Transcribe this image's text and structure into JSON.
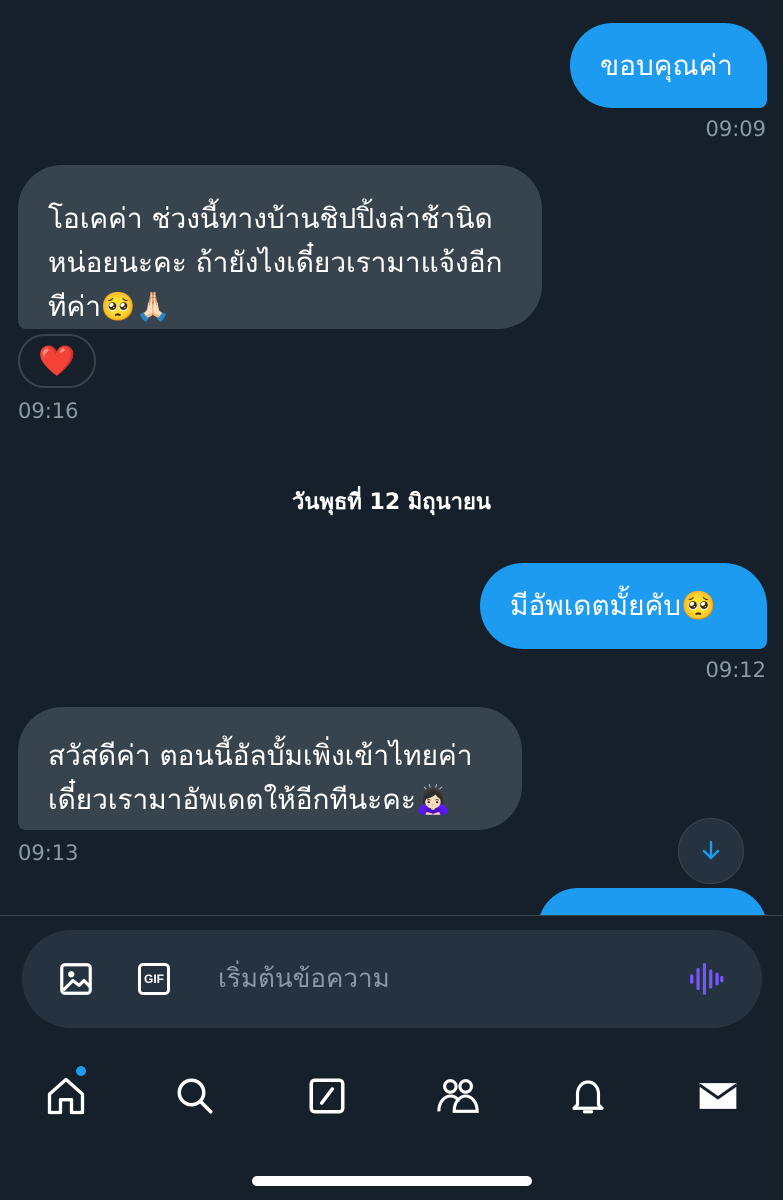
{
  "messages": [
    {
      "text": "ขอบคุณค่า",
      "time": "09:09"
    },
    {
      "line1": "โอเคค่า ช่วงนี้ทางบ้านชิปปิ้งล่าช้านิด",
      "line2": "หน่อยนะคะ ถ้ายังไงเดี๋ยวเรามาแจ้งอีก",
      "line3": "ทีค่า🥺🙏🏻",
      "reaction": "❤️",
      "time": "09:16"
    },
    {
      "text": "มีอัพเดตมั้ยคับ🥺",
      "time": "09:12"
    },
    {
      "line1": "สวัสดีค่า ตอนนี้อัลบั้มเพิ่งเข้าไทยค่า",
      "line2": "เดี๋ยวเรามาอัพเดตให้อีกทีนะคะ🙇🏻‍♀️",
      "time": "09:13"
    }
  ],
  "date_separator": "วันพุธที่ 12 มิถุนายน",
  "composer": {
    "placeholder": "เริ่มต้นข้อความ",
    "gif_label": "GIF"
  },
  "icons": {
    "image": "image-icon",
    "gif": "gif-icon",
    "voice": "voice-wave-icon",
    "scroll": "arrow-down-icon",
    "home": "home-icon",
    "search": "search-icon",
    "compose": "compose-icon",
    "communities": "communities-icon",
    "notifications": "bell-icon",
    "messages": "mail-icon"
  },
  "colors": {
    "background": "#15202b",
    "outgoing_bubble": "#1d9bf0",
    "incoming_bubble": "#38444d",
    "voice_icon": "#7856ff"
  }
}
